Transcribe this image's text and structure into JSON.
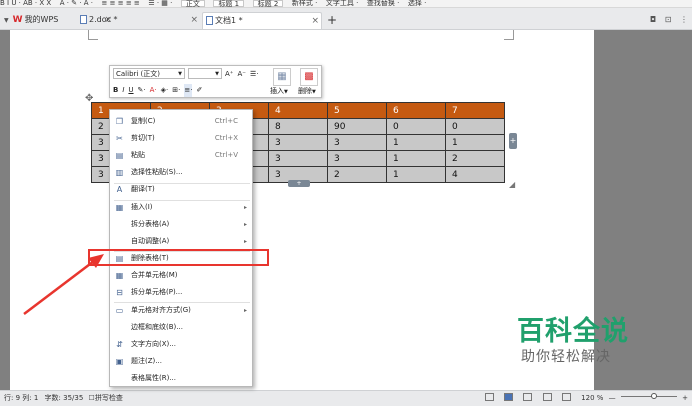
{
  "ribbon": {
    "items": [
      "B  I  U · AB · X  X",
      "A · ✎ · A ·",
      "≡ ≡ ≡ ≡ ≡",
      "☰ · ▦ ·",
      "正文",
      "标题 1",
      "标题 2",
      "新样式 ·",
      "文字工具 ·",
      "查找替换 ·",
      "选择 ·"
    ]
  },
  "tabs": [
    {
      "label": "我的WPS",
      "active": false
    },
    {
      "label": "2.doc *",
      "active": false
    },
    {
      "label": "文档1 *",
      "active": true
    }
  ],
  "tab_add": "+",
  "mini_toolbar": {
    "font_name": "Calibri (正文)",
    "font_size": "",
    "grow": "A⁺",
    "shrink": "A⁻",
    "bold": "B",
    "italic": "I",
    "underline": "U",
    "insert_label": "插入",
    "delete_label": "删除"
  },
  "table": {
    "header": [
      "1",
      "2",
      "3",
      "4",
      "5",
      "6",
      "7"
    ],
    "rows": [
      [
        "2",
        "",
        "",
        "8",
        "90",
        "0",
        "0"
      ],
      [
        "3",
        "",
        "",
        "3",
        "3",
        "1",
        "1"
      ],
      [
        "3",
        "",
        "",
        "3",
        "3",
        "1",
        "2"
      ],
      [
        "3",
        "",
        "",
        "3",
        "2",
        "1",
        "4"
      ]
    ],
    "header_color": "#c55a11"
  },
  "context_menu": {
    "items": [
      {
        "label": "复制(C)",
        "shortcut": "Ctrl+C",
        "icon": "copy-icon"
      },
      {
        "label": "剪切(T)",
        "shortcut": "Ctrl+X",
        "icon": "cut-icon"
      },
      {
        "label": "粘贴",
        "shortcut": "Ctrl+V",
        "icon": "paste-icon"
      },
      {
        "label": "选择性粘贴(S)...",
        "shortcut": "",
        "icon": "paste-special-icon"
      },
      {
        "label": "翻译(T)",
        "shortcut": "",
        "icon": "translate-icon"
      },
      {
        "label": "插入(I)",
        "shortcut": "",
        "icon": "insert-table-icon",
        "submenu": true
      },
      {
        "label": "拆分表格(A)",
        "shortcut": "",
        "icon": "",
        "submenu": true
      },
      {
        "label": "自动调整(A)",
        "shortcut": "",
        "icon": "",
        "submenu": true
      },
      {
        "label": "删除表格(T)",
        "shortcut": "",
        "icon": "delete-table-icon"
      },
      {
        "label": "合并单元格(M)",
        "shortcut": "",
        "icon": "merge-cells-icon"
      },
      {
        "label": "拆分单元格(P)...",
        "shortcut": "",
        "icon": "split-cells-icon"
      },
      {
        "label": "单元格对齐方式(G)",
        "shortcut": "",
        "icon": "cell-align-icon",
        "submenu": true
      },
      {
        "label": "边框和底纹(B)...",
        "shortcut": "",
        "icon": ""
      },
      {
        "label": "文字方向(X)...",
        "shortcut": "",
        "icon": "text-direction-icon"
      },
      {
        "label": "题注(Z)...",
        "shortcut": "",
        "icon": "caption-icon"
      },
      {
        "label": "表格属性(R)...",
        "shortcut": "",
        "icon": ""
      }
    ]
  },
  "watermark": {
    "title": "百科全说",
    "subtitle": "助你轻松解决"
  },
  "statusbar": {
    "position": "行: 9  列: 1",
    "word_count": "字数: 35/35",
    "spell_check": "拼写检查",
    "zoom": "120 %",
    "zoom_minus": "—",
    "zoom_plus": "+",
    "zoom_level": 0.6
  },
  "colors": {
    "highlight": "#e8352e",
    "arrow": "#e8352e",
    "watermark": "#20a06c"
  }
}
